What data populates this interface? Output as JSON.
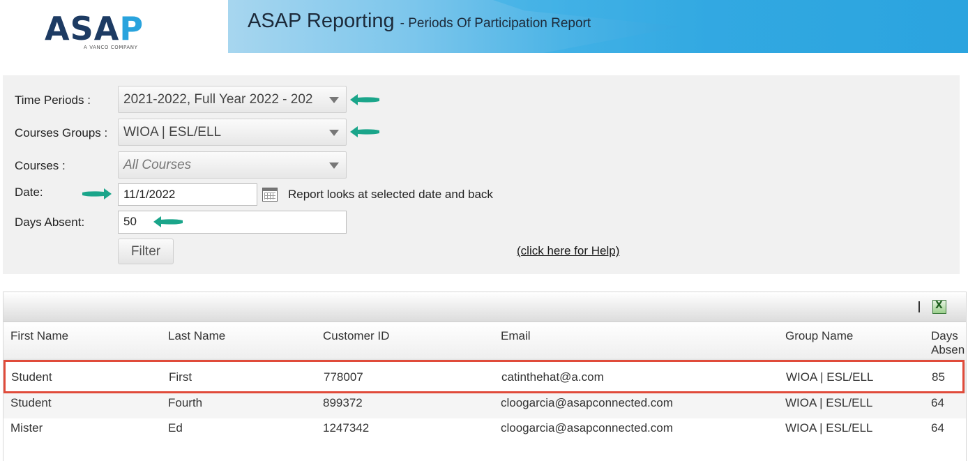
{
  "header": {
    "logo_main": "ASA",
    "logo_p": "P",
    "logo_sub": "A VANCO COMPANY",
    "title": "ASAP Reporting",
    "subtitle": "- Periods Of Participation Report"
  },
  "filters": {
    "time_periods_label": "Time Periods :",
    "time_periods_value": "2021-2022, Full Year 2022 - 202",
    "course_groups_label": "Courses Groups :",
    "course_groups_value": "WIOA | ESL/ELL",
    "courses_label": "Courses :",
    "courses_value": "All Courses",
    "date_label": "Date:",
    "date_value": "11/1/2022",
    "date_note": "Report looks at selected date and back",
    "days_absent_label": "Days Absent:",
    "days_absent_value": "50",
    "filter_button": "Filter",
    "help_link": "(click here for Help)"
  },
  "annotation_color": "#1aa58a",
  "highlight_color": "#e04b3a",
  "table": {
    "separator": "|",
    "columns": [
      "First Name",
      "Last Name",
      "Customer ID",
      "Email",
      "Group Name",
      "Days"
    ],
    "column_extra": "Absen",
    "rows": [
      {
        "first": "Student",
        "last": "First",
        "id": "778007",
        "email": "catinthehat@a.com",
        "group": "WIOA | ESL/ELL",
        "days": "85"
      },
      {
        "first": "Student",
        "last": "Fourth",
        "id": "899372",
        "email": "cloogarcia@asapconnected.com",
        "group": "WIOA | ESL/ELL",
        "days": "64"
      },
      {
        "first": "Mister",
        "last": "Ed",
        "id": "1247342",
        "email": "cloogarcia@asapconnected.com",
        "group": "WIOA | ESL/ELL",
        "days": "64"
      }
    ]
  }
}
